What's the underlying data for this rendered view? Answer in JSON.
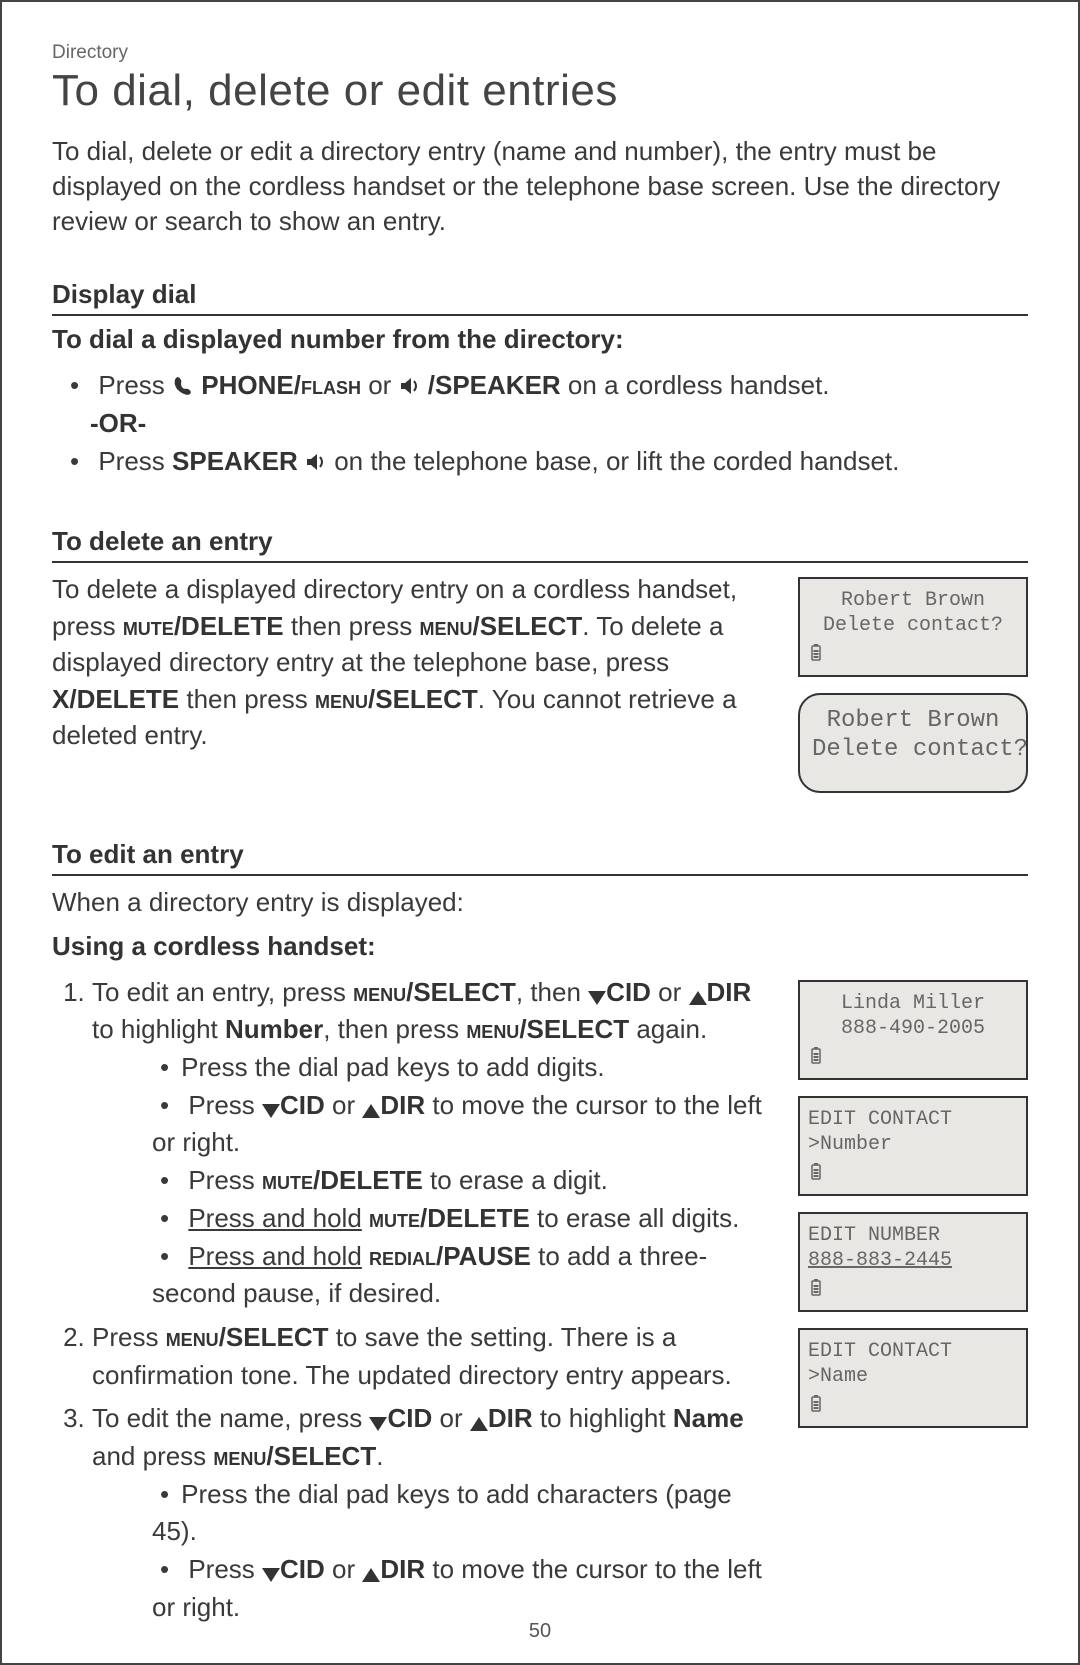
{
  "breadcrumb": "Directory",
  "title": "To dial, delete or edit entries",
  "intro": "To dial, delete or edit a directory entry (name and number), the entry must be displayed on the cordless handset or the telephone base screen. Use the directory review or search to show an entry.",
  "display_dial": {
    "heading": "Display dial",
    "subheading": "To dial a displayed number from the directory:",
    "b1_a": "Press ",
    "b1_b": "PHONE/",
    "b1_c": "flash",
    "b1_d": " or ",
    "b1_e": "/SPEAKER",
    "b1_f": " on a cordless handset.",
    "or": "-OR-",
    "b2_a": "Press ",
    "b2_b": "SPEAKER ",
    "b2_c": " on the telephone base, or lift the corded handset."
  },
  "delete": {
    "heading": "To delete an entry",
    "p_a": "To delete a displayed directory entry on a cordless handset, press ",
    "p_b": "mute",
    "p_c": "/DELETE",
    "p_d": " then press ",
    "p_e": "menu",
    "p_f": "/SELECT",
    "p_g": ". To delete a displayed directory entry at the telephone base, press ",
    "p_h": "X/DELETE",
    "p_i": " then press ",
    "p_j": "menu",
    "p_k": "/SELECT",
    "p_l": ". You cannot retrieve a deleted entry.",
    "lcd1": {
      "l1": "Robert Brown",
      "l2": "Delete contact?"
    },
    "lcd2": {
      "l1": "Robert Brown",
      "l2": "Delete contact?"
    }
  },
  "edit": {
    "heading": "To edit an entry",
    "intro": "When a directory entry is displayed:",
    "using": "Using a cordless handset:",
    "s1_a": "To edit an entry, press ",
    "s1_b": "menu",
    "s1_c": "/SELECT",
    "s1_d": ", then ",
    "s1_e": "CID",
    "s1_f": " or ",
    "s1_g": "DIR",
    "s1_h": " to highlight ",
    "s1_i": "Number",
    "s1_j": ", then press ",
    "s1_k": "menu",
    "s1_l": "/SELECT",
    "s1_m": " again.",
    "sub1": "Press the dial pad keys to add digits.",
    "sub2_a": "Press ",
    "sub2_b": "CID",
    "sub2_c": " or ",
    "sub2_d": "DIR",
    "sub2_e": " to move the cursor to the left or right.",
    "sub3_a": "Press ",
    "sub3_b": "mute",
    "sub3_c": "/DELETE",
    "sub3_d": " to erase a digit.",
    "sub4_a": "Press and hold",
    "sub4_b": " mute",
    "sub4_c": "/DELETE",
    "sub4_d": " to erase all digits.",
    "sub5_a": "Press and hold",
    "sub5_b": " redial",
    "sub5_c": "/PAUSE",
    "sub5_d": " to add a three-second pause, if desired.",
    "s2_a": "Press ",
    "s2_b": "menu",
    "s2_c": "/SELECT",
    "s2_d": " to save the setting. There is a confirmation tone. The updated directory entry appears.",
    "s3_a": "To edit the name, press ",
    "s3_b": "CID",
    "s3_c": " or ",
    "s3_d": "DIR",
    "s3_e": " to highlight ",
    "s3_f": "Name",
    "s3_g": " and press ",
    "s3_h": "menu",
    "s3_i": "/SELECT",
    "s3_j": ".",
    "sub6": "Press the dial pad keys to add characters (page 45).",
    "sub7_a": "Press ",
    "sub7_b": "CID",
    "sub7_c": " or ",
    "sub7_d": "DIR",
    "sub7_e": " to move the cursor to the left or right.",
    "lcd3": {
      "l1": "Linda Miller",
      "l2": "888-490-2005"
    },
    "lcd4": {
      "l1": "EDIT CONTACT",
      "l2": ">Number"
    },
    "lcd5": {
      "l1": "EDIT NUMBER",
      "l2": "888-883-2445"
    },
    "lcd6": {
      "l1": "EDIT CONTACT",
      "l2": ">Name"
    }
  },
  "page_number": "50"
}
